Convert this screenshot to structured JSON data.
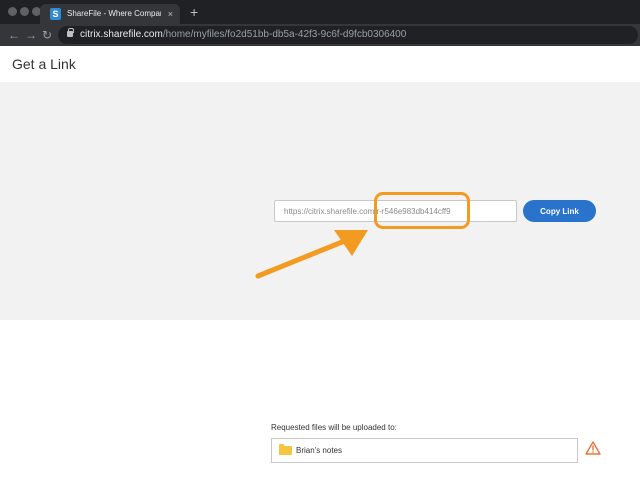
{
  "browser": {
    "tab": {
      "favicon_letter": "S",
      "title": "ShareFile - Where Companies Connect",
      "close_symbol": "×"
    },
    "new_tab_symbol": "+",
    "nav": {
      "back_icon": "arrow-left-icon",
      "forward_icon": "arrow-right-icon",
      "reload_icon": "reload-icon",
      "back_symbol": "←",
      "forward_symbol": "→",
      "reload_symbol": "↻"
    },
    "url_domain": "citrix.sharefile.com",
    "url_path": "/home/myfiles/fo2d51bb-db5a-42f3-9c6f-d9fcb0306400"
  },
  "page": {
    "title": "Get a Link",
    "link_value": "https://citrix.sharefile.com/r-r546e983db414cff9",
    "copy_button_label": "Copy Link",
    "upload_label": "Requested files will be uploaded to:",
    "folder_name": "Brian's notes",
    "folder_icon": "folder-icon",
    "warning_icon": "warning-icon"
  },
  "colors": {
    "accent": "#2a73cc",
    "highlight": "#f39a21",
    "warning": "#e8743b",
    "panel_bg": "#f2f2f2"
  }
}
